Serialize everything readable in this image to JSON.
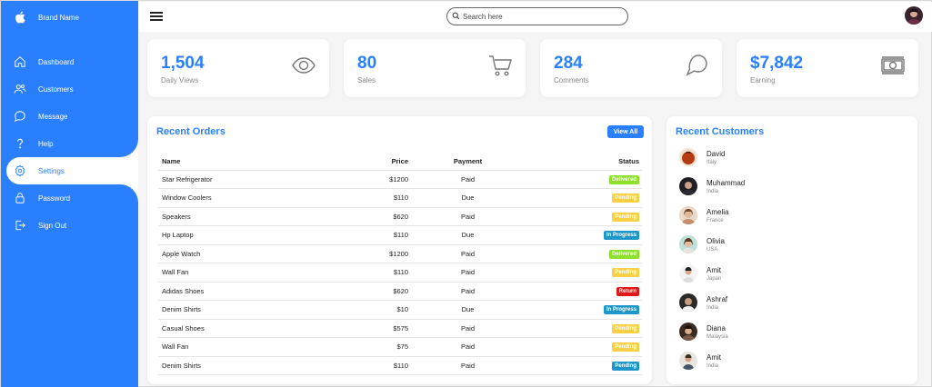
{
  "brand": {
    "name": "Brand Name",
    "icon": "apple-icon"
  },
  "nav": [
    {
      "label": "Dashboard",
      "icon": "home-icon"
    },
    {
      "label": "Customers",
      "icon": "users-icon"
    },
    {
      "label": "Message",
      "icon": "chat-icon"
    },
    {
      "label": "Help",
      "icon": "help-icon"
    },
    {
      "label": "Settings",
      "icon": "settings-icon",
      "active": true
    },
    {
      "label": "Password",
      "icon": "lock-icon"
    },
    {
      "label": "Sign Out",
      "icon": "sign-out-icon"
    }
  ],
  "search": {
    "placeholder": "Search here"
  },
  "cards": [
    {
      "value": "1,504",
      "label": "Daily Views",
      "icon": "eye-icon"
    },
    {
      "value": "80",
      "label": "Sales",
      "icon": "cart-icon"
    },
    {
      "value": "284",
      "label": "Comments",
      "icon": "comment-icon"
    },
    {
      "value": "$7,842",
      "label": "Earning",
      "icon": "money-icon"
    }
  ],
  "orders": {
    "title": "Recent Orders",
    "view_all": "View All",
    "headers": {
      "name": "Name",
      "price": "Price",
      "payment": "Payment",
      "status": "Status"
    },
    "rows": [
      {
        "name": "Star Refrigerator",
        "price": "$1200",
        "payment": "Paid",
        "status": "Delivered"
      },
      {
        "name": "Window Coolers",
        "price": "$110",
        "payment": "Due",
        "status": "Pending"
      },
      {
        "name": "Speakers",
        "price": "$620",
        "payment": "Paid",
        "status": "Pending"
      },
      {
        "name": "Hp Laptop",
        "price": "$110",
        "payment": "Due",
        "status": "In Progress"
      },
      {
        "name": "Apple Watch",
        "price": "$1200",
        "payment": "Paid",
        "status": "Delivered"
      },
      {
        "name": "Wall Fan",
        "price": "$110",
        "payment": "Paid",
        "status": "Pending"
      },
      {
        "name": "Adidas Shoes",
        "price": "$620",
        "payment": "Paid",
        "status": "Return"
      },
      {
        "name": "Denim Shirts",
        "price": "$10",
        "payment": "Due",
        "status": "In Progress"
      },
      {
        "name": "Casual Shoes",
        "price": "$575",
        "payment": "Paid",
        "status": "Pending"
      },
      {
        "name": "Wall Fan",
        "price": "$75",
        "payment": "Paid",
        "status": "Pending"
      },
      {
        "name": "Denim Shirts",
        "price": "$110",
        "payment": "Paid",
        "status": "Pending"
      }
    ]
  },
  "status_colors": {
    "Delivered": "#8de02c",
    "Pending": "#f7d046",
    "In Progress": "#1e96c8",
    "Return": "#e01717",
    "Pending-last": "#1e96c8"
  },
  "customers": {
    "title": "Recent Customers",
    "items": [
      {
        "name": "David",
        "country": "Italy"
      },
      {
        "name": "Muhammad",
        "country": "India"
      },
      {
        "name": "Amelia",
        "country": "France"
      },
      {
        "name": "Olivia",
        "country": "USA"
      },
      {
        "name": "Amit",
        "country": "Japan"
      },
      {
        "name": "Ashraf",
        "country": "India"
      },
      {
        "name": "Diana",
        "country": "Malaysia"
      },
      {
        "name": "Amit",
        "country": "India"
      }
    ]
  },
  "colors": {
    "accent": "#2a7fff",
    "background": "#f5f5f5"
  }
}
